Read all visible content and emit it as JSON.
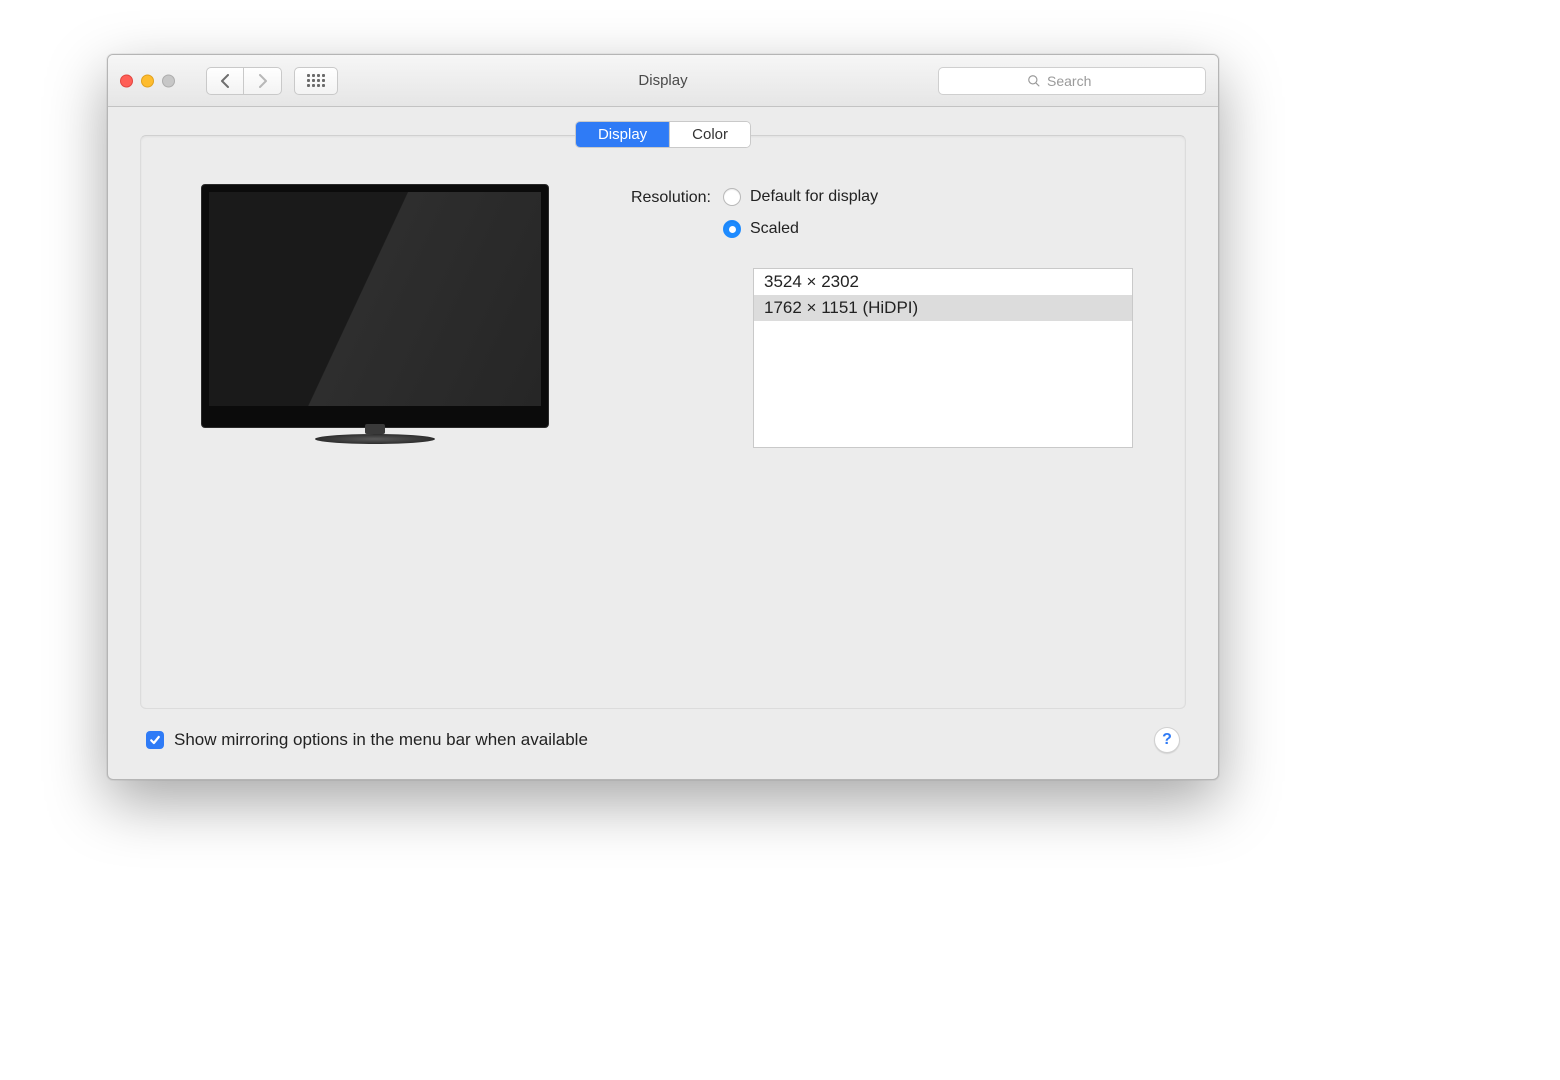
{
  "window": {
    "title": "Display"
  },
  "toolbar": {
    "search_placeholder": "Search"
  },
  "tabs": {
    "display": "Display",
    "color": "Color",
    "active": "display"
  },
  "resolution": {
    "label": "Resolution:",
    "options": {
      "default": "Default for display",
      "scaled": "Scaled"
    },
    "selected": "scaled",
    "scaled_list": [
      "3524 × 2302",
      "1762 × 1151 (HiDPI)"
    ],
    "scaled_selected_index": 1
  },
  "footer": {
    "mirroring_label": "Show mirroring options in the menu bar when available",
    "mirroring_checked": true,
    "help_label": "?"
  }
}
